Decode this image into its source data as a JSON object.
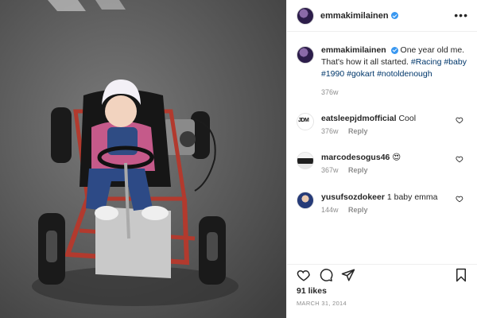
{
  "post": {
    "username": "emmakimilainen",
    "caption": {
      "username": "emmakimilainen",
      "text_before": "One year old me. That's how it all started.",
      "hashtags": [
        "#Racing",
        "#baby",
        "#1990",
        "#gokart",
        "#notoldenough"
      ],
      "time": "376w"
    },
    "comments": [
      {
        "username": "eatsleepjdmofficial",
        "text": "Cool",
        "time": "376w",
        "reply_label": "Reply",
        "avatar_text": "JDM"
      },
      {
        "username": "marcodesogus46",
        "text": "😍",
        "time": "367w",
        "reply_label": "Reply"
      },
      {
        "username": "yusufsozdokeer",
        "text": "1 baby emma",
        "time": "144w",
        "reply_label": "Reply"
      }
    ],
    "likes": "91 likes",
    "date": "MARCH 31, 2014"
  },
  "icons": {
    "more": "more-options-icon",
    "verified": "verified-badge-icon",
    "like": "heart-icon",
    "comment": "comment-bubble-icon",
    "share": "paper-plane-icon",
    "save": "bookmark-icon"
  },
  "colors": {
    "hashtag": "#00376b",
    "muted": "#8e8e8e",
    "verified": "#3897f0",
    "text": "#262626"
  }
}
